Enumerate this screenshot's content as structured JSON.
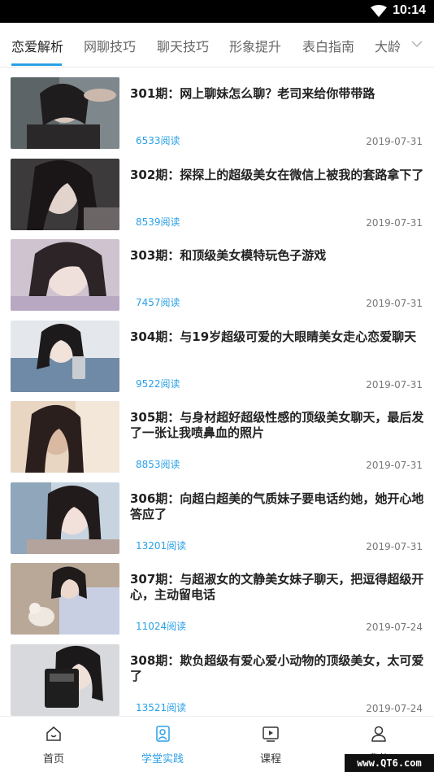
{
  "status_bar": {
    "time": "10:14"
  },
  "tabs": [
    {
      "label": "恋爱解析",
      "active": true
    },
    {
      "label": "网聊技巧",
      "active": false
    },
    {
      "label": "聊天技巧",
      "active": false
    },
    {
      "label": "形象提升",
      "active": false
    },
    {
      "label": "表白指南",
      "active": false
    },
    {
      "label": "大龄",
      "active": false
    }
  ],
  "articles": [
    {
      "title": "301期：网上聊妹怎么聊？老司来给你带带路",
      "reads": "6533阅读",
      "date": "2019-07-31"
    },
    {
      "title": "302期：探探上的超级美女在微信上被我的套路拿下了",
      "reads": "8539阅读",
      "date": "2019-07-31"
    },
    {
      "title": "303期：和顶级美女模特玩色子游戏",
      "reads": "7457阅读",
      "date": "2019-07-31"
    },
    {
      "title": "304期：与19岁超级可爱的大眼睛美女走心恋爱聊天",
      "reads": "9522阅读",
      "date": "2019-07-31"
    },
    {
      "title": "305期：与身材超好超级性感的顶级美女聊天，最后发了一张让我喷鼻血的照片",
      "reads": "8853阅读",
      "date": "2019-07-31"
    },
    {
      "title": "306期：向超白超美的气质妹子要电话约她，她开心地答应了",
      "reads": "13201阅读",
      "date": "2019-07-31"
    },
    {
      "title": "307期：与超淑女的文静美女妹子聊天，把逗得超级开心，主动留电话",
      "reads": "11024阅读",
      "date": "2019-07-24"
    },
    {
      "title": "308期：欺负超级有爱心爱小动物的顶级美女，太可爱了",
      "reads": "13521阅读",
      "date": "2019-07-24"
    }
  ],
  "bottom_nav": [
    {
      "label": "首页",
      "icon": "home-icon",
      "active": false
    },
    {
      "label": "学堂实践",
      "icon": "practice-icon",
      "active": true
    },
    {
      "label": "课程",
      "icon": "video-course-icon",
      "active": false
    },
    {
      "label": "我的",
      "icon": "user-icon",
      "active": false
    }
  ],
  "watermark": "www.QT6.com",
  "colors": {
    "accent": "#2aa0e6",
    "status_bar": "#000000",
    "date_text": "#777777"
  }
}
